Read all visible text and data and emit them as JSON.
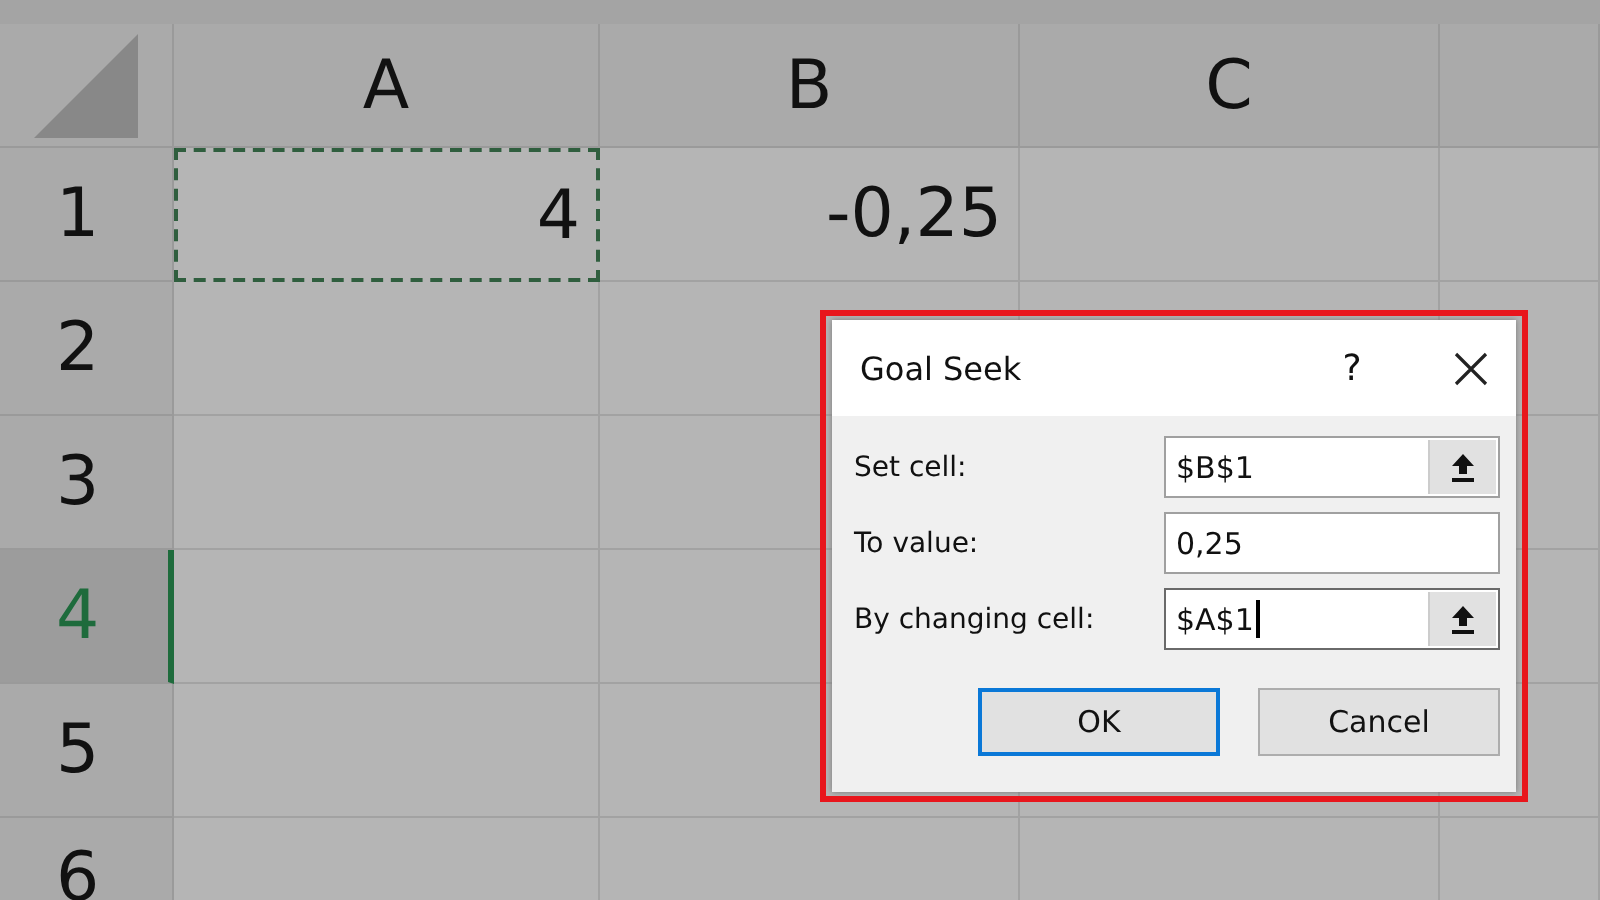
{
  "sheet": {
    "columns": [
      {
        "label": "A",
        "selected": false
      },
      {
        "label": "B",
        "selected": false
      },
      {
        "label": "C",
        "selected": false
      }
    ],
    "rows": [
      {
        "label": "1",
        "selected": false,
        "cells": [
          {
            "value": "4",
            "marked": true
          },
          {
            "value": "-0,25",
            "marked": false
          }
        ]
      },
      {
        "label": "2",
        "selected": false
      },
      {
        "label": "3",
        "selected": false
      },
      {
        "label": "4",
        "selected": true
      },
      {
        "label": "5",
        "selected": false
      },
      {
        "label": "6",
        "selected": false
      }
    ]
  },
  "dialog": {
    "title": "Goal Seek",
    "help": "?",
    "outlined": true,
    "fields": [
      {
        "label": "Set cell:",
        "value": "$B$1",
        "kind": "reference",
        "focused": false
      },
      {
        "label": "To value:",
        "value": "0,25",
        "kind": "text",
        "focused": false
      },
      {
        "label": "By changing cell:",
        "value": "$A$1",
        "kind": "reference",
        "focused": true
      }
    ],
    "buttons": [
      {
        "label": "OK",
        "default": true
      },
      {
        "label": "Cancel",
        "default": false
      }
    ]
  }
}
